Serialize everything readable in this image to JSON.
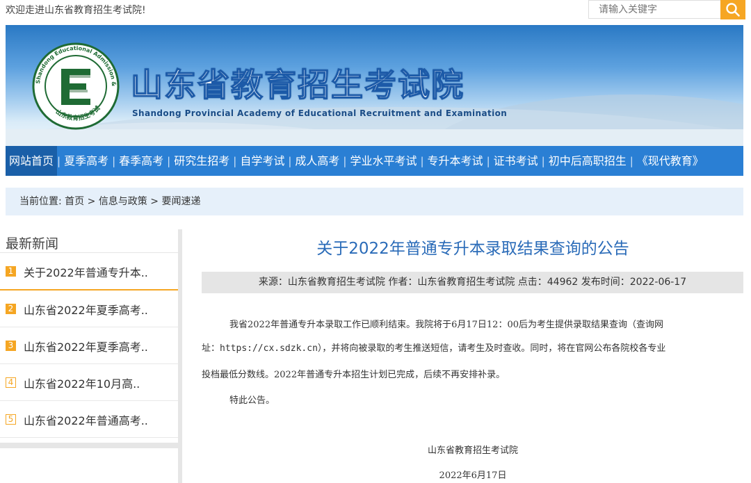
{
  "topbar": {
    "welcome": "欢迎走进山东省教育招生考试院!",
    "search_placeholder": "请输入关键字"
  },
  "banner": {
    "site_name": "山东省教育招生考试院",
    "site_name_en": "Shandong Provincial Academy of Educational Recruitment and Examination",
    "emblem_ring_text": "Shandong Educational Admission & Examinations",
    "emblem_bottom_text": "山东教育招生考试"
  },
  "nav": {
    "items": [
      "网站首页",
      "夏季高考",
      "春季高考",
      "研究生招考",
      "自学考试",
      "成人高考",
      "学业水平考试",
      "专升本考试",
      "证书考试",
      "初中后高职招生",
      "《现代教育》"
    ],
    "active_index": 0,
    "color": "#2a7fd4"
  },
  "breadcrumb": {
    "prefix": "当前位置:",
    "home": "首页",
    "sep": ">",
    "level1": "信息与政策",
    "level2": "要闻速递"
  },
  "sidebar": {
    "title": "最新新闻",
    "items": [
      {
        "num": "1",
        "text": "关于2022年普通专升本.."
      },
      {
        "num": "2",
        "text": "山东省2022年夏季高考.."
      },
      {
        "num": "3",
        "text": "山东省2022年夏季高考.."
      },
      {
        "num": "4",
        "text": "山东省2022年10月高.."
      },
      {
        "num": "5",
        "text": "山东省2022年普通高考.."
      }
    ]
  },
  "article": {
    "title": "关于2022年普通专升本录取结果查询的公告",
    "meta": "来源：山东省教育招生考试院 作者：山东省教育招生考试院 点击：44962 发布时间：2022-06-17",
    "p1_line1": "我省2022年普通专升本录取工作已顺利结束。我院将于6月17日12：00后为考生提供录取结果查询（查询网",
    "p1_line2_prefix": "址：",
    "p1_url": "https://cx.sdzk.cn",
    "p1_line2_suffix": "），并将向被录取的考生推送短信，请考生及时查收。同时，将在官网公布各院校各专业",
    "p1_line3": "投档最低分数线。2022年普通专升本招生计划已完成，后续不再安排补录。",
    "p2": "特此公告。",
    "signature": "山东省教育招生考试院",
    "date": "2022年6月17日"
  },
  "colors": {
    "accent_orange": "#f5a623",
    "title_blue": "#2a6bb8",
    "crumb_bg": "#e6f0fa"
  }
}
